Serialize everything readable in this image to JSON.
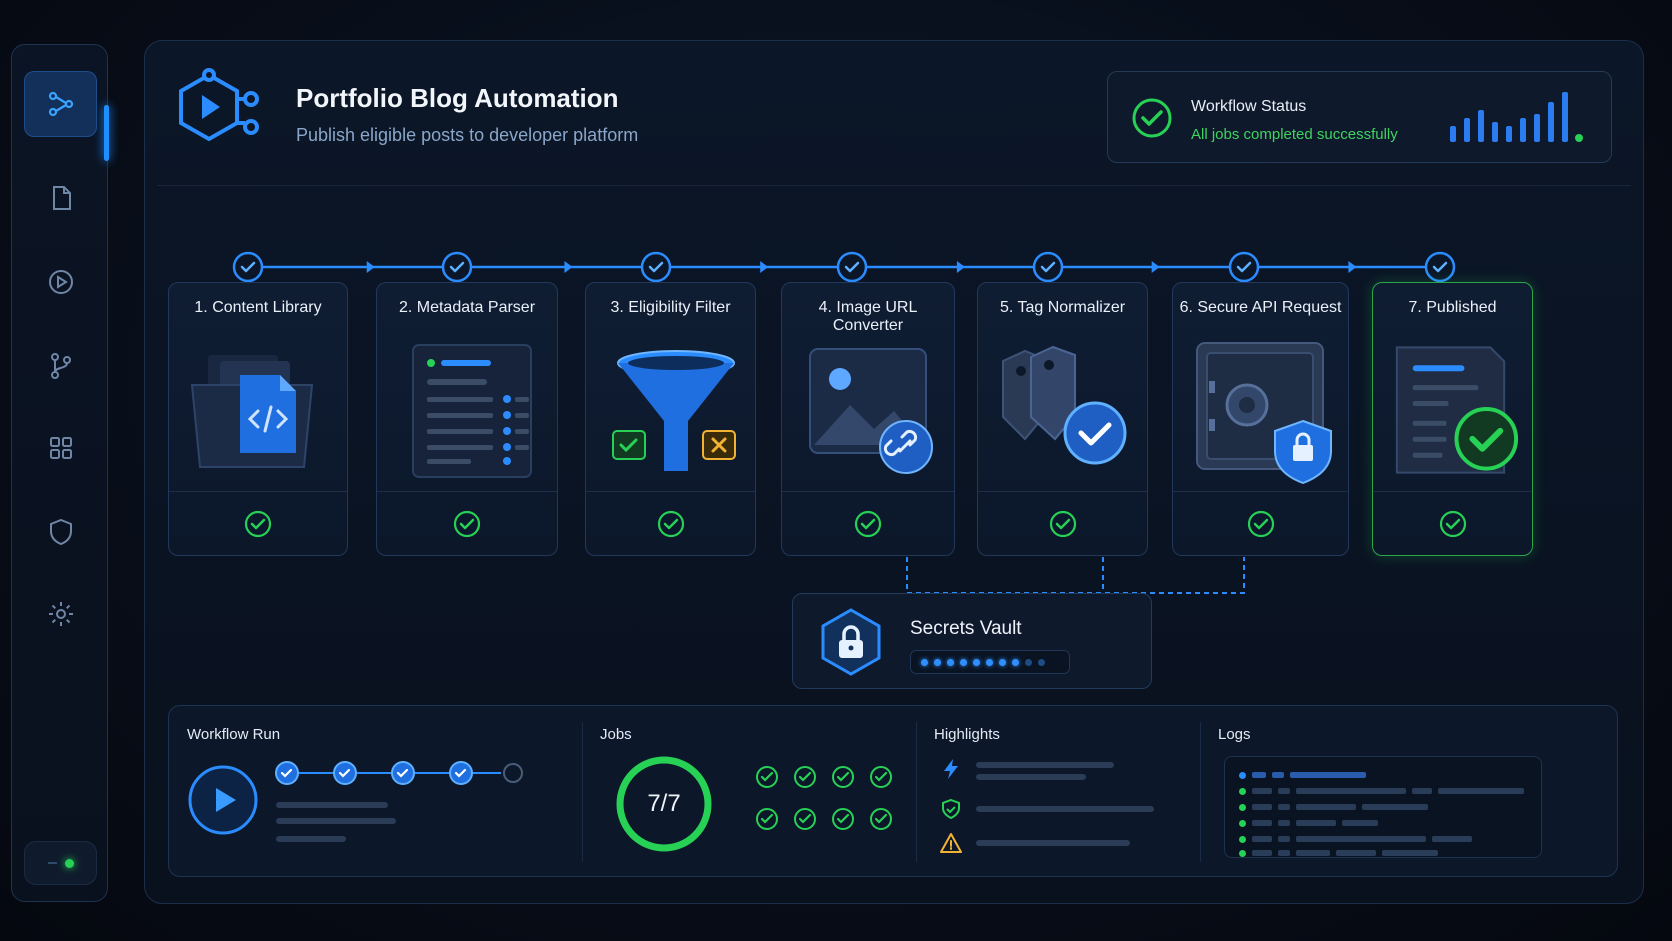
{
  "app": {
    "title": "Portfolio Blog Automation",
    "subtitle": "Publish eligible posts to developer platform"
  },
  "sidebar": {
    "items": [
      {
        "icon": "workflow-icon",
        "active": true
      },
      {
        "icon": "document-icon"
      },
      {
        "icon": "play-icon"
      },
      {
        "icon": "branch-icon"
      },
      {
        "icon": "grid-icon"
      },
      {
        "icon": "shield-icon"
      },
      {
        "icon": "gear-icon"
      }
    ]
  },
  "workflow_status": {
    "title": "Workflow Status",
    "message": "All jobs completed successfully",
    "color": "#3fd35f"
  },
  "steps": [
    {
      "label": "1. Content Library",
      "status": "complete"
    },
    {
      "label": "2. Metadata Parser",
      "status": "complete"
    },
    {
      "label": "3. Eligibility Filter",
      "status": "complete"
    },
    {
      "label": "4. Image URL Converter",
      "status": "complete"
    },
    {
      "label": "5. Tag Normalizer",
      "status": "complete"
    },
    {
      "label": "6. Secure API Request",
      "status": "complete"
    },
    {
      "label": "7. Published",
      "status": "complete"
    }
  ],
  "vault": {
    "title": "Secrets Vault"
  },
  "bottom": {
    "run": {
      "title": "Workflow Run",
      "steps_completed": 4,
      "steps_total": 5
    },
    "jobs": {
      "title": "Jobs",
      "count": "7/7"
    },
    "highlights": {
      "title": "Highlights",
      "icons": [
        "lightning-icon",
        "shield-check-icon",
        "warning-icon"
      ]
    },
    "logs": {
      "title": "Logs"
    }
  },
  "colors": {
    "accent": "#1f8fff",
    "success": "#27d155",
    "warning": "#f2b233"
  }
}
